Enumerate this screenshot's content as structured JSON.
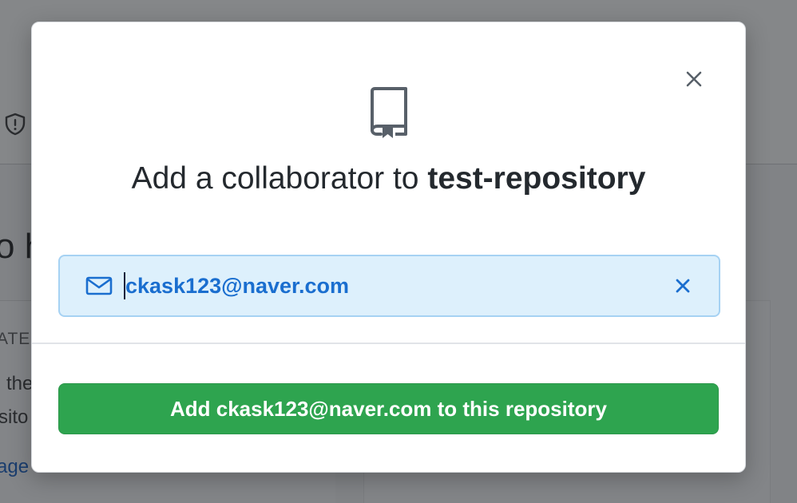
{
  "background": {
    "heading_fragment": "o h",
    "section_fragment": "ATE",
    "text_line_1": "the",
    "text_line_2": "sito",
    "link_fragment": "age"
  },
  "modal": {
    "title_prefix": "Add a collaborator to ",
    "repository_name": "test-repository",
    "email_value": "ckask123@naver.com",
    "submit_label": "Add ckask123@naver.com to this repository",
    "icons": {
      "close": "close-icon",
      "repo": "repo-icon",
      "mail": "mail-icon",
      "clear": "clear-icon",
      "shield": "shield-icon"
    }
  },
  "colors": {
    "primary_button": "#2ea44f",
    "selected_field_bg": "#ddf0fc",
    "selected_field_border": "#a6d2f3",
    "link_blue": "#1a6ecf",
    "text_dark": "#24292e",
    "overlay": "#818386"
  }
}
